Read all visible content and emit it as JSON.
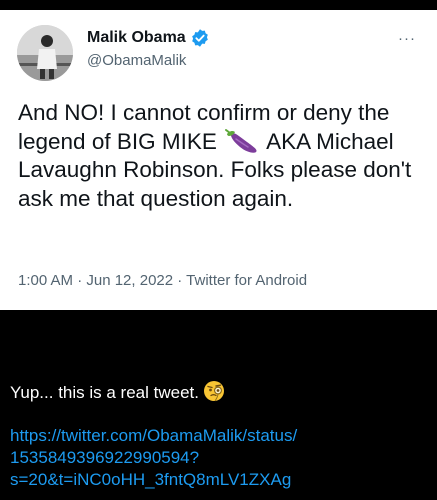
{
  "tweet": {
    "author_name": "Malik Obama",
    "author_handle": "@ObamaMalik",
    "more_menu": "···",
    "text_before_emoji": "And NO! I cannot confirm or deny the legend of BIG MIKE ",
    "emoji": "eggplant",
    "text_after_emoji": " AKA Michael Lavaughn Robinson. Folks please don't ask me that question again.",
    "meta": "1:00 AM · Jun 12, 2022 · Twitter for Android",
    "verified_color": "#1d9bf0"
  },
  "message": {
    "text": "Yup... this is a real tweet.",
    "emoji": "face-with-monocle",
    "link_lines": [
      "https://twitter.com/ObamaMalik/status/",
      "1535849396922990594?",
      "s=20&t=iNC0oHH_3fntQ8mLV1ZXAg"
    ],
    "link_color": "#1d9bf0"
  }
}
